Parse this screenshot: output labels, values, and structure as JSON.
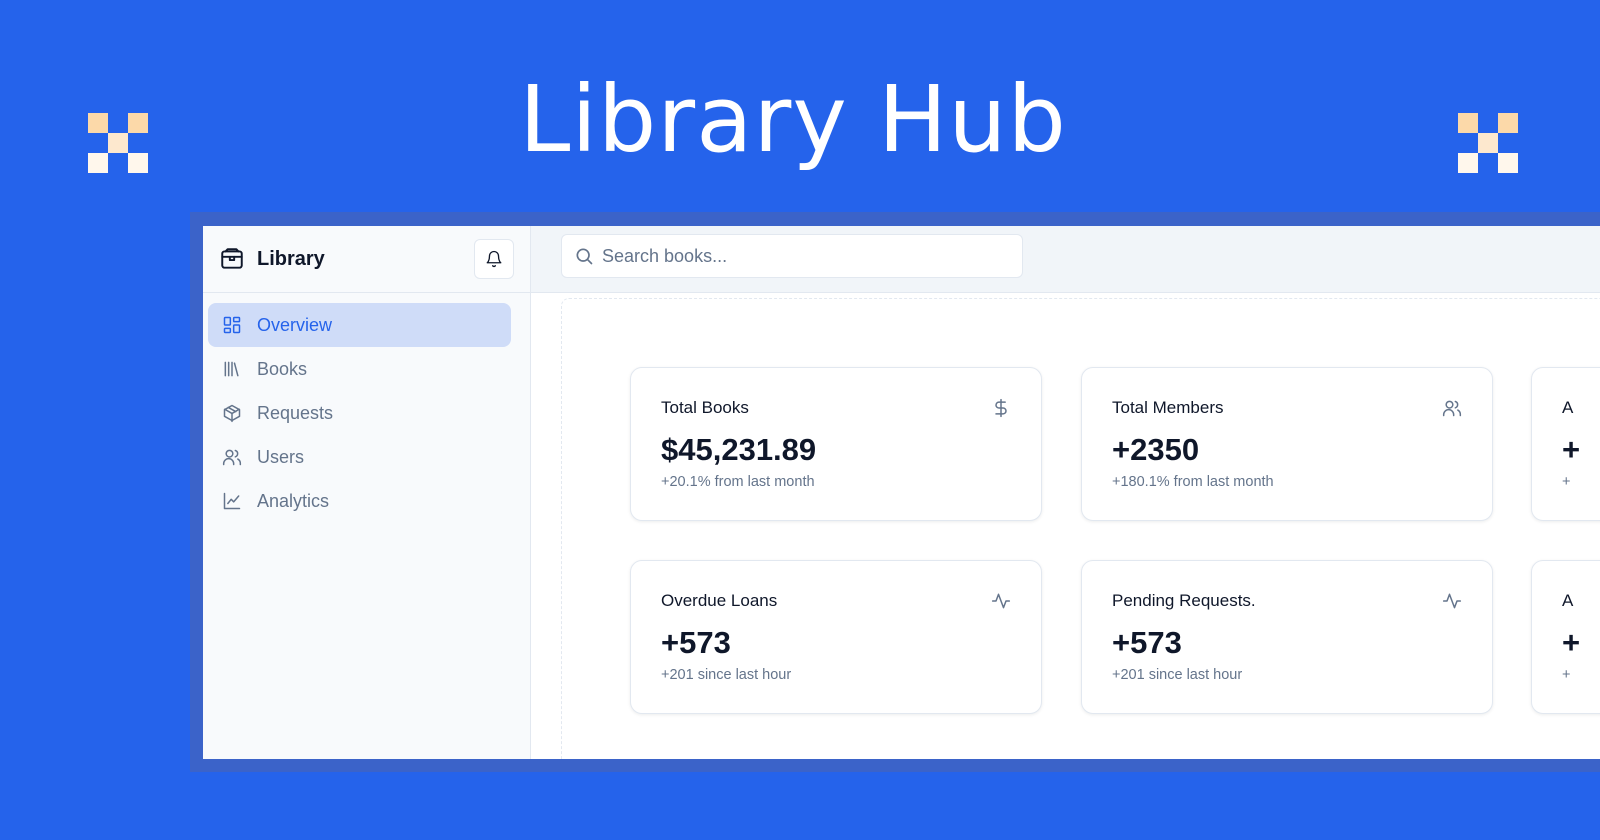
{
  "hero": {
    "title": "Library Hub"
  },
  "colors": {
    "background": "#2563eb",
    "accent": "#2563eb",
    "active_bg": "#cfdcf8",
    "checker": [
      "#fcd9a9",
      "#fde8ce"
    ]
  },
  "sidebar": {
    "brand": {
      "name": "Library",
      "icon": "box-icon"
    },
    "notification_icon": "bell-icon",
    "items": [
      {
        "label": "Overview",
        "icon": "dashboard-icon",
        "active": true
      },
      {
        "label": "Books",
        "icon": "library-icon",
        "active": false
      },
      {
        "label": "Requests",
        "icon": "package-icon",
        "active": false
      },
      {
        "label": "Users",
        "icon": "users-icon",
        "active": false
      },
      {
        "label": "Analytics",
        "icon": "line-chart-icon",
        "active": false
      }
    ]
  },
  "search": {
    "placeholder": "Search books...",
    "icon": "search-icon"
  },
  "cards": [
    {
      "title": "Total Books",
      "value": "$45,231.89",
      "sub": "+20.1% from last month",
      "icon": "dollar-icon"
    },
    {
      "title": "Total Members",
      "value": "+2350",
      "sub": "+180.1% from last month",
      "icon": "users-icon"
    },
    {
      "title": "A",
      "value": "+",
      "sub": "+",
      "icon": ""
    },
    {
      "title": "Overdue Loans",
      "value": "+573",
      "sub": "+201 since last hour",
      "icon": "activity-icon"
    },
    {
      "title": "Pending Requests.",
      "value": "+573",
      "sub": "+201 since last hour",
      "icon": "activity-icon"
    },
    {
      "title": "A",
      "value": "+",
      "sub": "+",
      "icon": ""
    }
  ]
}
